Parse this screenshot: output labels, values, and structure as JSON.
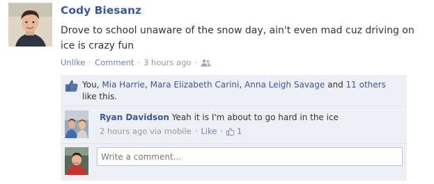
{
  "post": {
    "author": "Cody Biesanz",
    "text": "Drove to school unaware of the snow day, ain't even mad cuz driving on ice is crazy fun",
    "actions": {
      "unlike": "Unlike",
      "comment": "Comment",
      "timestamp": "3 hours ago",
      "separator": "·",
      "audience_icon": "friends-icon"
    }
  },
  "likes": {
    "icon": "thumbs-up-icon",
    "prefix": "You,",
    "names": [
      "Mia Harrie",
      "Mara Elizabeth Carini",
      "Anna Leigh Savage"
    ],
    "separator": ",",
    "and_text": "and",
    "others_link": "11 others",
    "suffix": "like this."
  },
  "comments": [
    {
      "author": "Ryan Davidson",
      "text": "Yeah it is I'm about to go hard in the ice",
      "timestamp": "2 hours ago via mobile",
      "like_label": "Like",
      "like_count": "1"
    }
  ],
  "composer": {
    "placeholder": "Write a comment..."
  },
  "colors": {
    "link": "#3b5998",
    "muted_link": "#6d84b4",
    "muted_text": "#999999",
    "ufi_background": "#edeff4",
    "input_border": "#bdc7d8"
  }
}
